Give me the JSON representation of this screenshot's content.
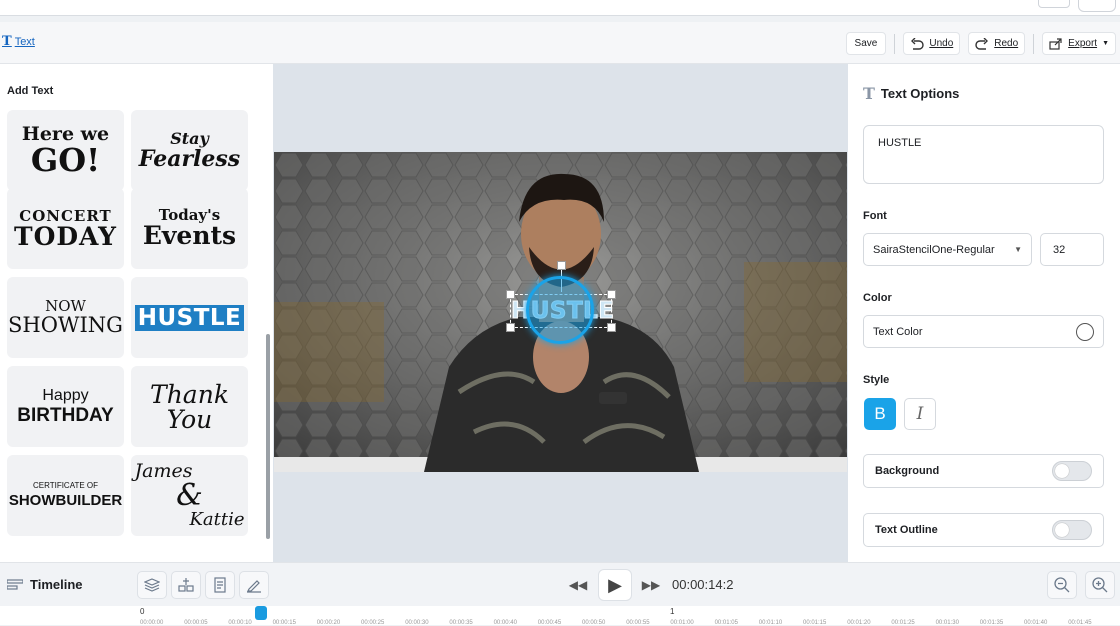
{
  "toolbar": {
    "active_tool": "Text",
    "save_label": "Save",
    "undo_label": "Undo",
    "redo_label": "Redo",
    "export_label": "Export"
  },
  "left_panel": {
    "title": "Add Text",
    "templates": [
      {
        "line1": "Here we",
        "line2": "GO!"
      },
      {
        "line1": "Stay",
        "line2": "Fearless"
      },
      {
        "line1": "CONCERT",
        "line2": "TODAY"
      },
      {
        "line1": "Today's",
        "line2": "Events"
      },
      {
        "line1": "NOW",
        "line2": "SHOWING"
      },
      {
        "line1": "HUSTLE"
      },
      {
        "line1": "Happy",
        "line2": "BIRTHDAY"
      },
      {
        "line1": "Thank",
        "line2": "You"
      },
      {
        "line1": "CERTIFICATE OF",
        "line2": "SHOWBUILDER"
      },
      {
        "line1": "James",
        "line2": "&",
        "line3": "Kattie"
      }
    ]
  },
  "canvas": {
    "overlay_text": "HUSTLE"
  },
  "right_panel": {
    "title": "Text Options",
    "text_value": "HUSTLE",
    "font_label": "Font",
    "font_value": "SairaStencilOne-Regular",
    "font_size": "32",
    "color_label": "Color",
    "color_value": "Text Color",
    "style_label": "Style",
    "bold_label": "B",
    "italic_label": "I",
    "background_label": "Background",
    "outline_label": "Text Outline"
  },
  "timeline": {
    "label": "Timeline",
    "time": "00:00:14:2",
    "marker_0": "0",
    "marker_1": "1",
    "ticks": [
      "00:00:00",
      "00:00:05",
      "00:00:10",
      "00:00:15",
      "00:00:20",
      "00:00:25",
      "00:00:30",
      "00:00:35",
      "00:00:40",
      "00:00:45",
      "00:00:50",
      "00:00:55",
      "00:01:00",
      "00:01:05",
      "00:01:10",
      "00:01:15",
      "00:01:20",
      "00:01:25",
      "00:01:30",
      "00:01:35",
      "00:01:40",
      "00:01:45"
    ]
  },
  "colors": {
    "accent": "#1aa3e8",
    "link": "#1565c0",
    "hustle_bg": "#1f7fc4"
  }
}
